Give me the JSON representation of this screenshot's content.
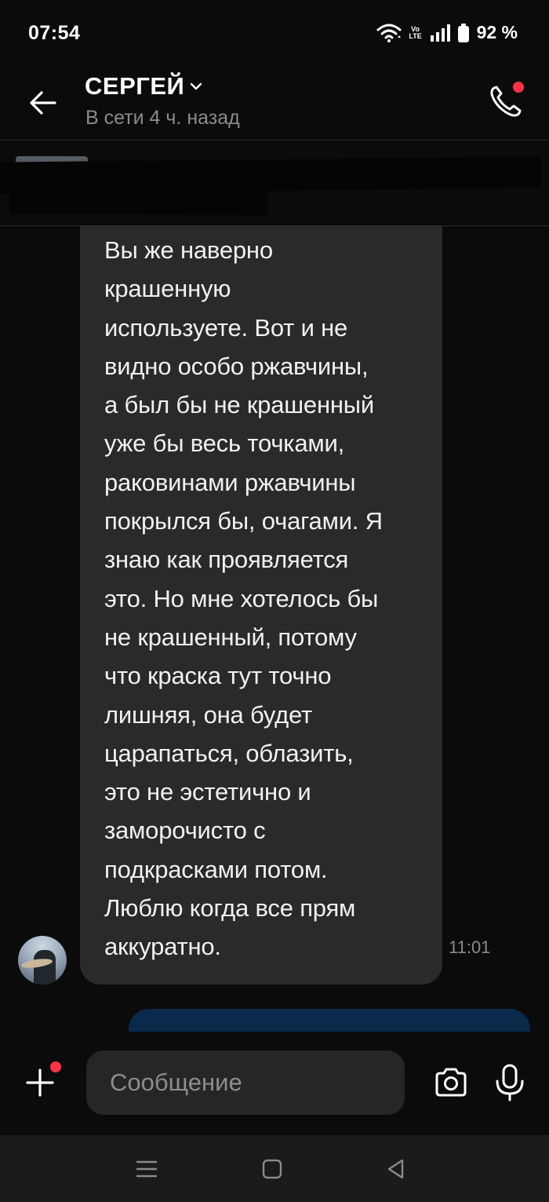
{
  "status_bar": {
    "time": "07:54",
    "network_label_top": "Vo",
    "network_label_bottom": "LTE",
    "battery": "92 %"
  },
  "header": {
    "contact_name": "СЕРГЕЙ",
    "contact_status": "В сети 4 ч. назад",
    "has_call_notification": true
  },
  "pinned": {
    "redacted": true
  },
  "messages": [
    {
      "direction": "incoming",
      "text": "Вы же наверно\nкрашенную\nиспользуете. Вот и не\nвидно особо ржавчины,\nа был бы не крашенный\nуже бы весь точками,\nраковинами ржавчины\nпокрылся бы, очагами. Я\nзнаю как проявляется\nэто. Но мне хотелось бы\nне крашенный, потому\nчто краска тут точно\nлишняя, она будет\nцарапаться, облазить,\nэто не эстетично и\nзаморочисто с\nподкрасками потом.\nЛюблю когда все прям\nаккуратно.",
      "time": "11:01"
    }
  ],
  "composer": {
    "placeholder": "Сообщение",
    "value": ""
  },
  "colors": {
    "background": "#0b0b0b",
    "incoming_bubble": "#2a2a2a",
    "outgoing_bubble": "#0a2a4c",
    "notification_dot": "#ff3347",
    "secondary_text": "#8b8b8b"
  },
  "icons": {
    "back": "arrow-left-icon",
    "dropdown": "chevron-down-icon",
    "call": "phone-icon",
    "attach": "plus-icon",
    "camera": "camera-icon",
    "mic": "microphone-icon",
    "nav_recents": "recents-icon",
    "nav_home": "home-icon",
    "nav_back": "back-triangle-icon"
  }
}
